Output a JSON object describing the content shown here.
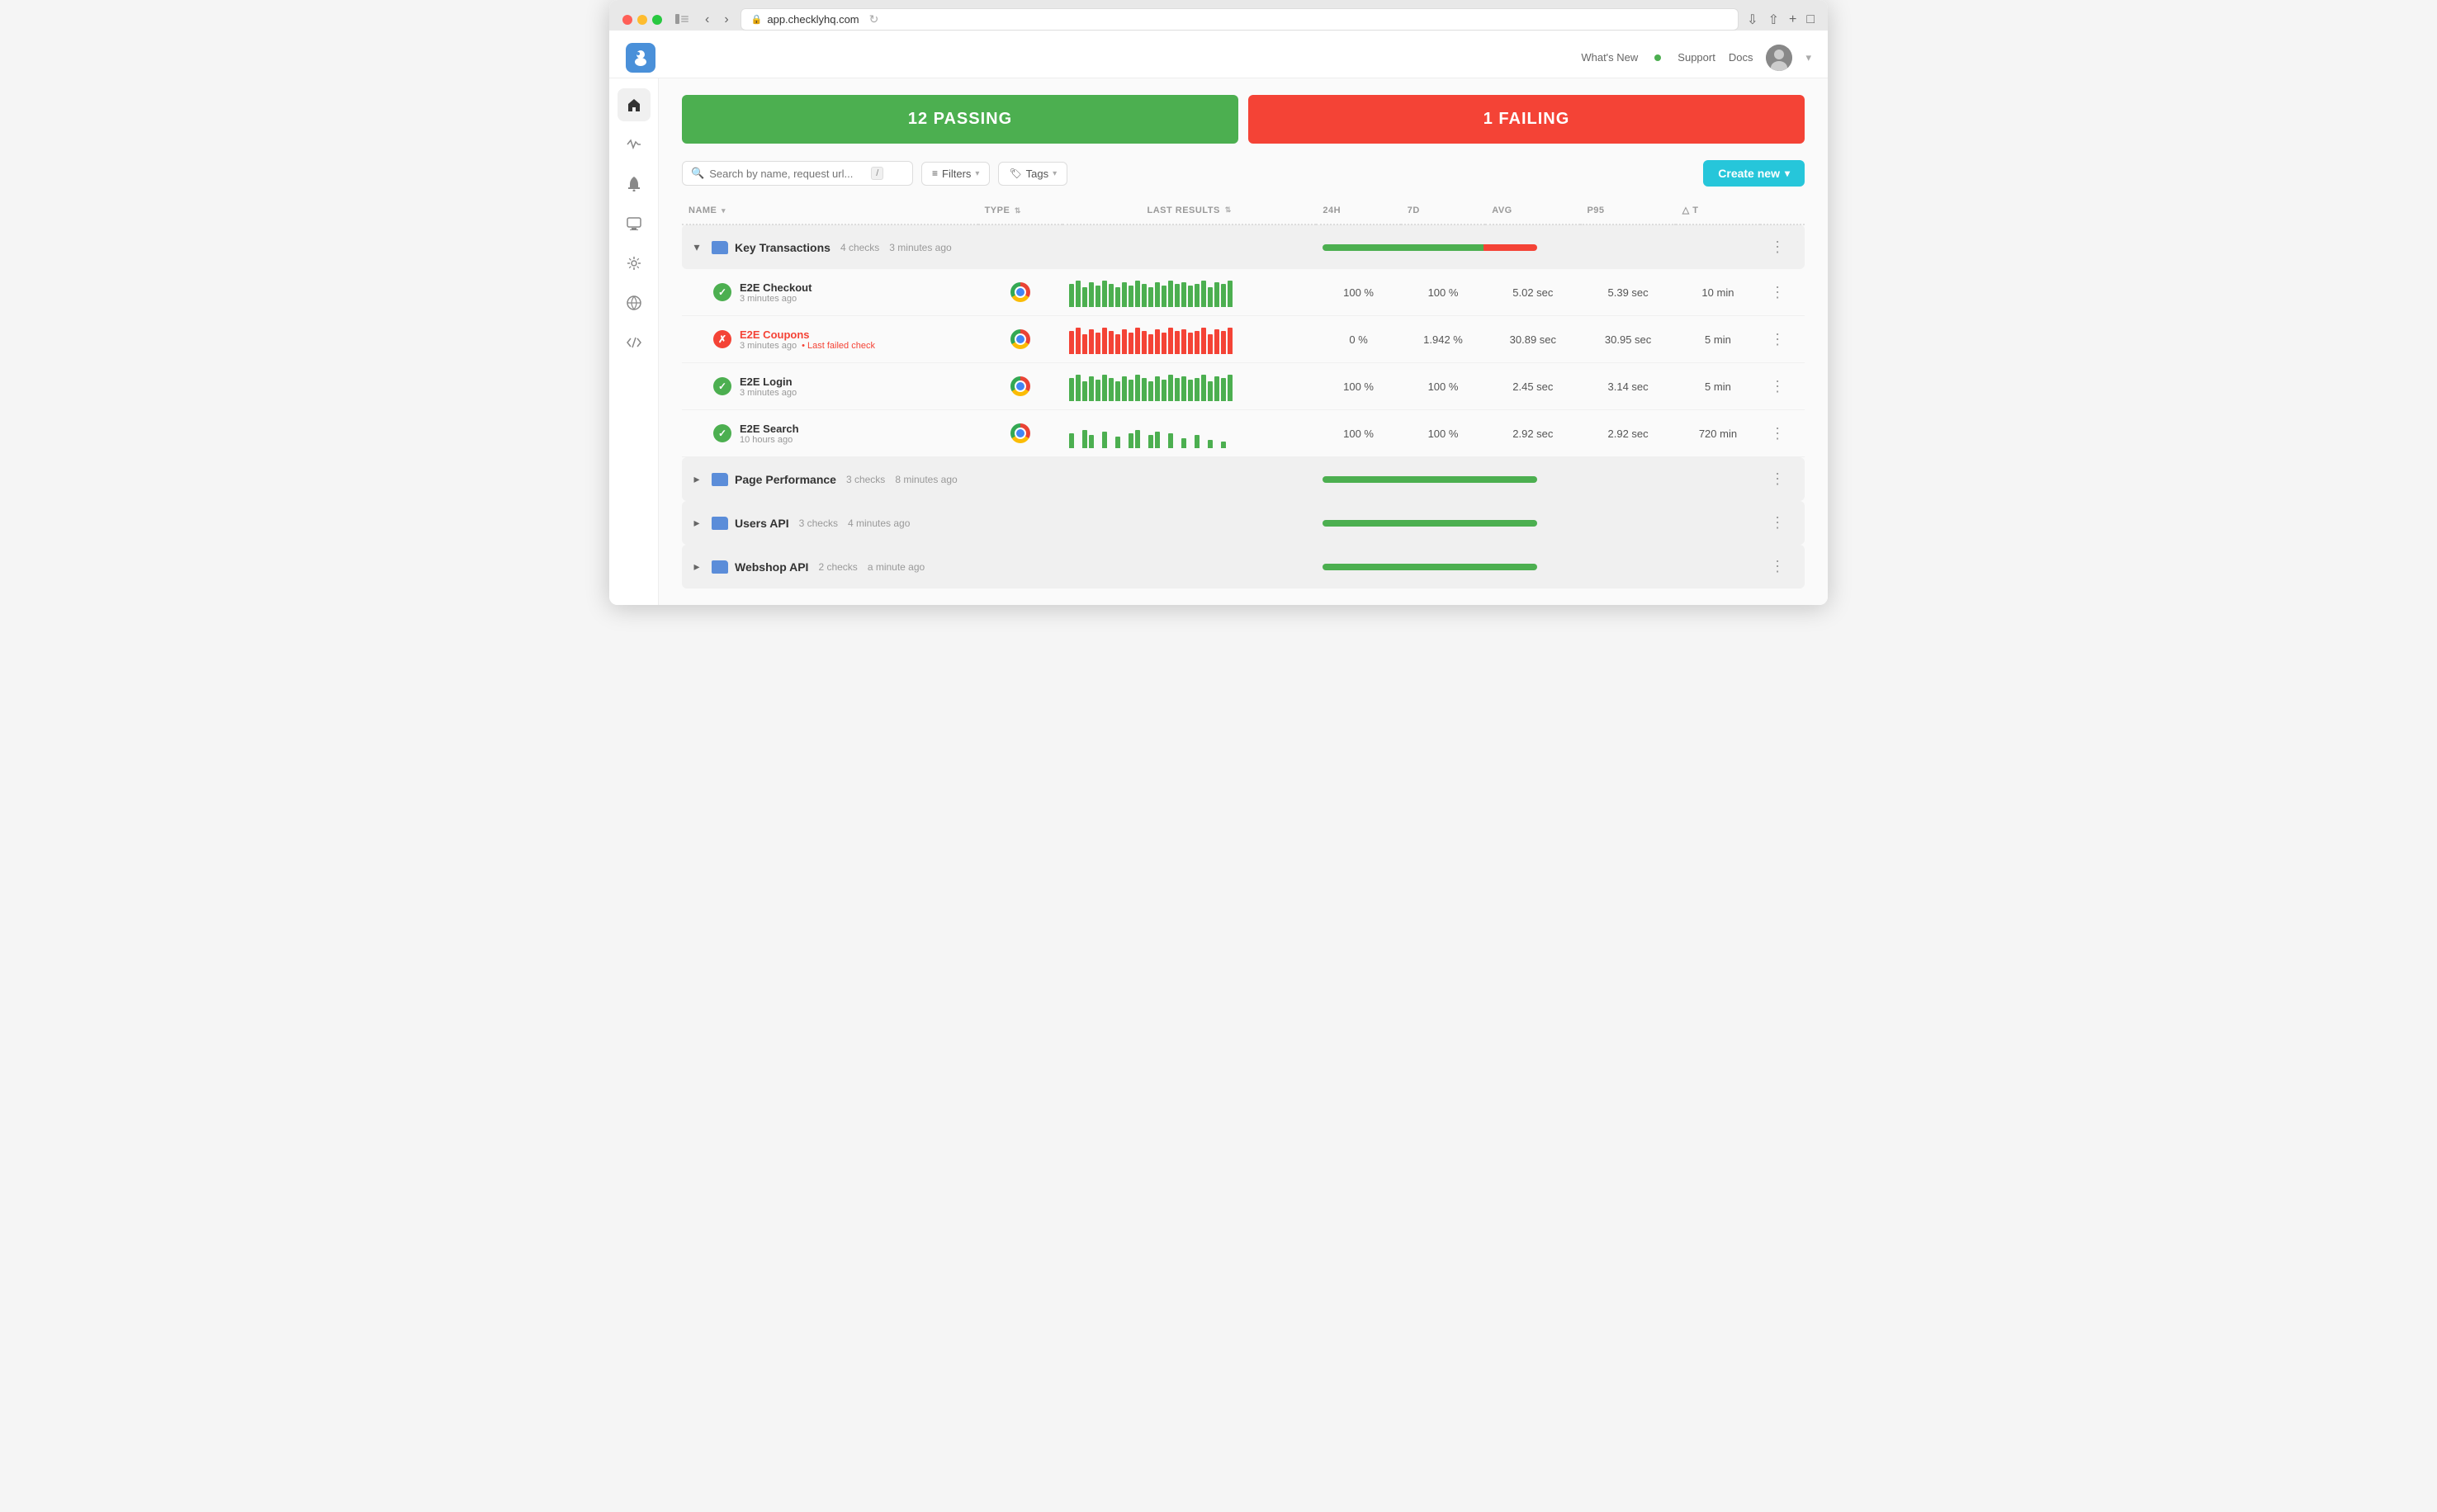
{
  "browser": {
    "url": "app.checklyhq.com",
    "refresh_icon": "↻"
  },
  "topbar": {
    "whats_new": "What's New",
    "support": "Support",
    "docs": "Docs"
  },
  "summary": {
    "passing_label": "12 PASSING",
    "failing_label": "1 FAILING"
  },
  "toolbar": {
    "search_placeholder": "Search by name, request url...",
    "shortcut": "/",
    "filters_label": "Filters",
    "tags_label": "Tags",
    "create_new_label": "Create new"
  },
  "table": {
    "columns": {
      "name": "NAME",
      "type": "TYPE",
      "last_results": "LAST RESULTS",
      "h24": "24H",
      "d7": "7D",
      "avg": "AVG",
      "p95": "P95",
      "dt": "△ T"
    },
    "groups": [
      {
        "name": "Key Transactions",
        "checks_count": "4 checks",
        "time_ago": "3 minutes ago",
        "expanded": true,
        "progress": {
          "green": 75,
          "red": 25
        },
        "checks": [
          {
            "name": "E2E Checkout",
            "time": "3 minutes ago",
            "status": "pass",
            "failing": false,
            "extra": "",
            "h24": "100 %",
            "d7": "100 %",
            "avg": "5.02 sec",
            "p95": "5.39 sec",
            "dt": "10 min",
            "bars": "pass"
          },
          {
            "name": "E2E Coupons",
            "time": "3 minutes ago",
            "status": "fail",
            "failing": true,
            "extra": "Last failed check",
            "h24": "0 %",
            "d7": "1.942 %",
            "avg": "30.89 sec",
            "p95": "30.95 sec",
            "dt": "5 min",
            "bars": "fail"
          },
          {
            "name": "E2E Login",
            "time": "3 minutes ago",
            "status": "pass",
            "failing": false,
            "extra": "",
            "h24": "100 %",
            "d7": "100 %",
            "avg": "2.45 sec",
            "p95": "3.14 sec",
            "dt": "5 min",
            "bars": "pass"
          },
          {
            "name": "E2E Search",
            "time": "10 hours ago",
            "status": "pass",
            "failing": false,
            "extra": "",
            "h24": "100 %",
            "d7": "100 %",
            "avg": "2.92 sec",
            "p95": "2.92 sec",
            "dt": "720 min",
            "bars": "sparse"
          }
        ]
      },
      {
        "name": "Page Performance",
        "checks_count": "3 checks",
        "time_ago": "8 minutes ago",
        "expanded": false,
        "progress": {
          "green": 100,
          "red": 0
        }
      },
      {
        "name": "Users API",
        "checks_count": "3 checks",
        "time_ago": "4 minutes ago",
        "expanded": false,
        "progress": {
          "green": 100,
          "red": 0
        }
      },
      {
        "name": "Webshop API",
        "checks_count": "2 checks",
        "time_ago": "a minute ago",
        "expanded": false,
        "progress": {
          "green": 100,
          "red": 0
        }
      }
    ]
  },
  "sidebar": {
    "items": [
      {
        "icon": "⌂",
        "name": "home",
        "active": true
      },
      {
        "icon": "∿",
        "name": "activity",
        "active": false
      },
      {
        "icon": "🔔",
        "name": "alerts",
        "active": false
      },
      {
        "icon": "▣",
        "name": "monitors",
        "active": false
      },
      {
        "icon": "⚡",
        "name": "integrations",
        "active": false
      },
      {
        "icon": "⊕",
        "name": "api",
        "active": false
      },
      {
        "icon": "◈",
        "name": "code",
        "active": false
      }
    ]
  }
}
